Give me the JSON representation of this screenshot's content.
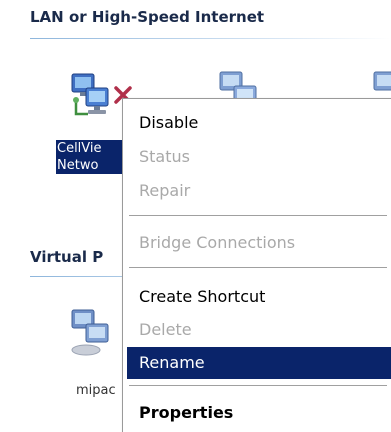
{
  "sections": {
    "lan": {
      "title": "LAN or High-Speed Internet"
    },
    "vpn": {
      "title": "Virtual P"
    }
  },
  "icons": {
    "cellview": {
      "label_line1": "CellVie",
      "label_line2": "Netwo",
      "status": "disconnected"
    },
    "vpn": {
      "label": "mipac"
    }
  },
  "context_menu": {
    "items": [
      {
        "label": "Disable",
        "state": "enabled"
      },
      {
        "label": "Status",
        "state": "disabled"
      },
      {
        "label": "Repair",
        "state": "disabled"
      },
      {
        "label": "Bridge Connections",
        "state": "disabled"
      },
      {
        "label": "Create Shortcut",
        "state": "enabled"
      },
      {
        "label": "Delete",
        "state": "disabled"
      },
      {
        "label": "Rename",
        "state": "highlighted"
      },
      {
        "label": "Properties",
        "state": "default"
      }
    ]
  },
  "colors": {
    "selection": "#0a246a",
    "disabled_text": "#a9a9a9",
    "header_text": "#1a2a4a",
    "disconnect_x": "#b0304a"
  }
}
